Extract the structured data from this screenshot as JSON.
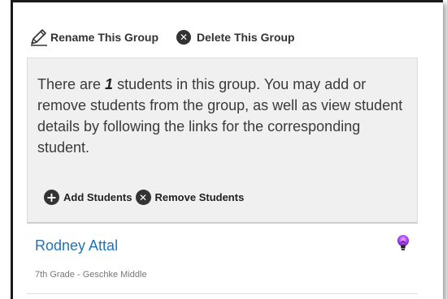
{
  "toolbar": {
    "rename_label": "Rename This Group",
    "delete_label": "Delete This Group",
    "rename_icon": "pencil-icon",
    "delete_icon": "x-circle-icon"
  },
  "info": {
    "text_before": "There are ",
    "student_count": "1",
    "text_after": " students in this group. You may add or remove students from the group, as well as view student details by following the links for the corresponding student.",
    "add_label": "Add Students",
    "remove_label": "Remove Students",
    "add_icon": "plus-circle-icon",
    "remove_icon": "x-circle-icon"
  },
  "students": [
    {
      "name": "Rodney Attal",
      "detail": "7th Grade - Geschke Middle",
      "indicator_icon": "lightbulb-icon",
      "indicator_color": "#a020f0"
    }
  ],
  "colors": {
    "link": "#1f73b7",
    "panel_bg": "#f0f0f0",
    "icon_dark": "#333333"
  }
}
